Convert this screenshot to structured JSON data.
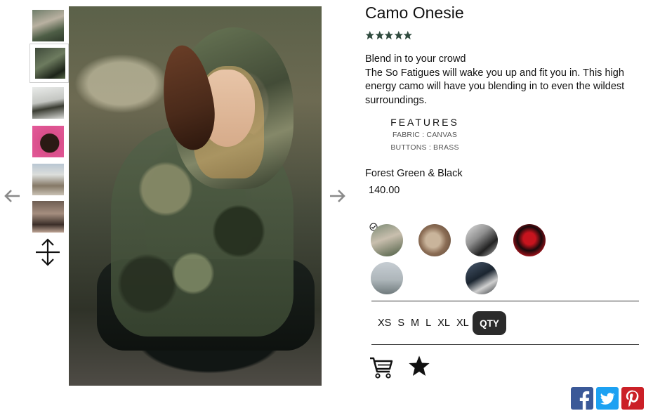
{
  "product": {
    "title": "Camo Onesie",
    "rating": 5,
    "rating_max": 5,
    "description_headline": "Blend in to your crowd",
    "description_body": "The So Fatigues will wake you up and fit you in. This high energy camo will have you blending in to even the wildest surroundings.",
    "features_title": "FEATURES",
    "features": [
      "FABRIC : CANVAS",
      "BUTTONS : BRASS"
    ],
    "color_name": "Forest Green & Black",
    "price": "140.00"
  },
  "gallery": {
    "selected_index": 1,
    "thumbnails": [
      "thumb-1",
      "thumb-2",
      "thumb-3",
      "thumb-4",
      "thumb-5",
      "thumb-6"
    ]
  },
  "swatches": {
    "selected_index": 0,
    "items": [
      "swatch-1",
      "swatch-2",
      "swatch-3",
      "swatch-4",
      "swatch-5",
      "swatch-6"
    ]
  },
  "sizes": [
    "XS",
    "S",
    "M",
    "L",
    "XL",
    "XL"
  ],
  "qty_label": "QTY",
  "icons": {
    "prev": "arrow-left-icon",
    "next": "arrow-right-icon",
    "expand": "expand-vertical-icon",
    "cart": "shopping-cart-icon",
    "favorite": "star-icon",
    "facebook": "facebook-icon",
    "twitter": "twitter-icon",
    "pinterest": "pinterest-icon"
  },
  "colors": {
    "star": "#2f4a3e",
    "arrow": "#8a8a8a",
    "facebook": "#3b5998",
    "twitter": "#1da1f2",
    "pinterest": "#cb2027",
    "qty_bg": "#2b2b2b"
  }
}
